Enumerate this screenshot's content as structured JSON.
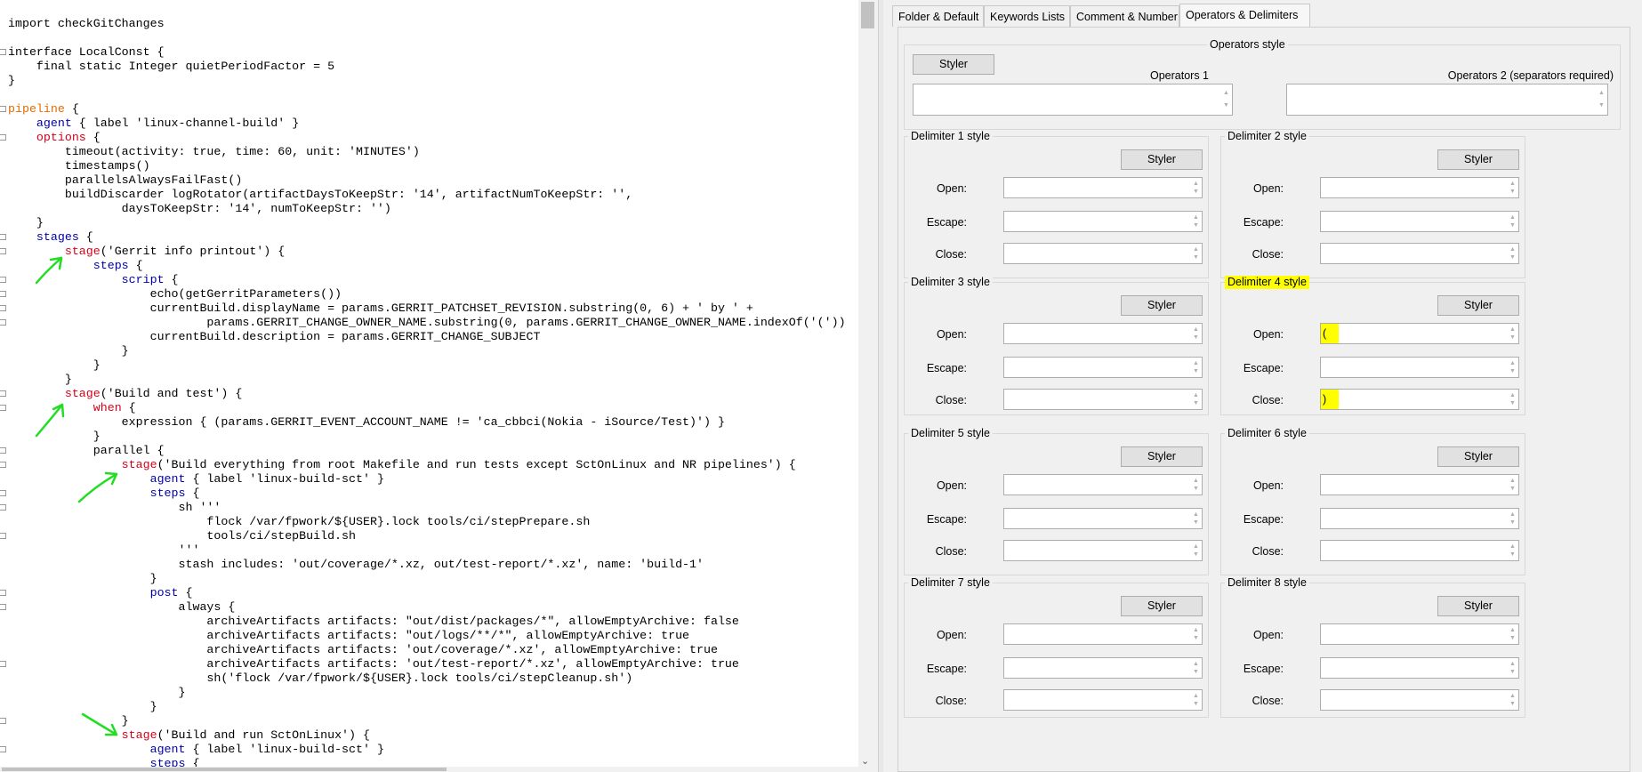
{
  "editor": {
    "lines": [
      [
        [
          "import checkGitChanges",
          ""
        ]
      ],
      [
        [
          "",
          ""
        ]
      ],
      [
        [
          "interface LocalConst {",
          ""
        ]
      ],
      [
        [
          "    final static Integer quietPeriodFactor = 5",
          ""
        ]
      ],
      [
        [
          "}",
          ""
        ]
      ],
      [
        [
          "",
          ""
        ]
      ],
      [
        [
          "pipeline",
          "o"
        ],
        [
          " {",
          ""
        ]
      ],
      [
        [
          "    ",
          ""
        ],
        [
          "agent",
          "k"
        ],
        [
          " { label 'linux-channel-build' }",
          ""
        ]
      ],
      [
        [
          "    ",
          ""
        ],
        [
          "options",
          "r"
        ],
        [
          " {",
          ""
        ]
      ],
      [
        [
          "        timeout(activity: true, time: 60, unit: 'MINUTES')",
          ""
        ]
      ],
      [
        [
          "        timestamps()",
          ""
        ]
      ],
      [
        [
          "        parallelsAlwaysFailFast()",
          ""
        ]
      ],
      [
        [
          "        buildDiscarder logRotator(artifactDaysToKeepStr: '14', artifactNumToKeepStr: '',",
          ""
        ]
      ],
      [
        [
          "                daysToKeepStr: '14', numToKeepStr: '')",
          ""
        ]
      ],
      [
        [
          "    }",
          ""
        ]
      ],
      [
        [
          "    ",
          ""
        ],
        [
          "stages",
          "k"
        ],
        [
          " {",
          ""
        ]
      ],
      [
        [
          "        ",
          ""
        ],
        [
          "stage",
          "r"
        ],
        [
          "('Gerrit info printout') {",
          ""
        ]
      ],
      [
        [
          "            ",
          ""
        ],
        [
          "steps",
          "k"
        ],
        [
          " {",
          ""
        ]
      ],
      [
        [
          "                ",
          ""
        ],
        [
          "script",
          "k"
        ],
        [
          " {",
          ""
        ]
      ],
      [
        [
          "                    echo(getGerritParameters())",
          ""
        ]
      ],
      [
        [
          "                    currentBuild.displayName = params.GERRIT_PATCHSET_REVISION.substring(0, 6) + ' by ' +",
          ""
        ]
      ],
      [
        [
          "                            params.GERRIT_CHANGE_OWNER_NAME.substring(0, params.GERRIT_CHANGE_OWNER_NAME.indexOf('('))",
          ""
        ]
      ],
      [
        [
          "                    currentBuild.description = params.GERRIT_CHANGE_SUBJECT",
          ""
        ]
      ],
      [
        [
          "                }",
          ""
        ]
      ],
      [
        [
          "            }",
          ""
        ]
      ],
      [
        [
          "        }",
          ""
        ]
      ],
      [
        [
          "        ",
          ""
        ],
        [
          "stage",
          "r"
        ],
        [
          "('Build and test') {",
          ""
        ]
      ],
      [
        [
          "            ",
          ""
        ],
        [
          "when",
          "r"
        ],
        [
          " {",
          ""
        ]
      ],
      [
        [
          "                expression { (params.GERRIT_EVENT_ACCOUNT_NAME != 'ca_cbbci(Nokia - iSource/Test)') }",
          ""
        ]
      ],
      [
        [
          "            }",
          ""
        ]
      ],
      [
        [
          "            parallel {",
          ""
        ]
      ],
      [
        [
          "                ",
          ""
        ],
        [
          "stage",
          "r"
        ],
        [
          "('Build everything from root Makefile and run tests except SctOnLinux and NR pipelines') {",
          ""
        ]
      ],
      [
        [
          "                    ",
          ""
        ],
        [
          "agent",
          "k"
        ],
        [
          " { label 'linux-build-sct' }",
          ""
        ]
      ],
      [
        [
          "                    ",
          ""
        ],
        [
          "steps",
          "k"
        ],
        [
          " {",
          ""
        ]
      ],
      [
        [
          "                        sh '''",
          ""
        ]
      ],
      [
        [
          "                            flock /var/fpwork/${USER}.lock tools/ci/stepPrepare.sh",
          ""
        ]
      ],
      [
        [
          "                            tools/ci/stepBuild.sh",
          ""
        ]
      ],
      [
        [
          "                        '''",
          ""
        ]
      ],
      [
        [
          "                        stash includes: 'out/coverage/*.xz, out/test-report/*.xz', name: 'build-1'",
          ""
        ]
      ],
      [
        [
          "                    }",
          ""
        ]
      ],
      [
        [
          "                    ",
          ""
        ],
        [
          "post",
          "k"
        ],
        [
          " {",
          ""
        ]
      ],
      [
        [
          "                        always {",
          ""
        ]
      ],
      [
        [
          "                            archiveArtifacts artifacts: \"out/dist/packages/*\", allowEmptyArchive: false",
          ""
        ]
      ],
      [
        [
          "                            archiveArtifacts artifacts: \"out/logs/**/*\", allowEmptyArchive: true",
          ""
        ]
      ],
      [
        [
          "                            archiveArtifacts artifacts: 'out/coverage/*.xz', allowEmptyArchive: true",
          ""
        ]
      ],
      [
        [
          "                            archiveArtifacts artifacts: 'out/test-report/*.xz', allowEmptyArchive: true",
          ""
        ]
      ],
      [
        [
          "                            sh('flock /var/fpwork/${USER}.lock tools/ci/stepCleanup.sh')",
          ""
        ]
      ],
      [
        [
          "                        }",
          ""
        ]
      ],
      [
        [
          "                    }",
          ""
        ]
      ],
      [
        [
          "                }",
          ""
        ]
      ],
      [
        [
          "                ",
          ""
        ],
        [
          "stage",
          "r"
        ],
        [
          "('Build and run SctOnLinux') {",
          ""
        ]
      ],
      [
        [
          "                    ",
          ""
        ],
        [
          "agent",
          "k"
        ],
        [
          " { label 'linux-build-sct' }",
          ""
        ]
      ],
      [
        [
          "                    ",
          ""
        ],
        [
          "steps",
          "k"
        ],
        [
          " {",
          ""
        ]
      ]
    ]
  },
  "settings": {
    "tabs": [
      "Folder & Default",
      "Keywords Lists",
      "Comment & Number",
      "Operators & Delimiters"
    ],
    "active_tab": "Operators & Delimiters",
    "operators": {
      "title": "Operators style",
      "styler": "Styler",
      "op1_label": "Operators 1",
      "op2_label": "Operators 2 (separators required)",
      "op1_value": "",
      "op2_value": ""
    },
    "labels": {
      "open": "Open:",
      "escape": "Escape:",
      "close": "Close:",
      "styler": "Styler"
    },
    "delimiters": [
      {
        "title": "Delimiter 1 style",
        "open": "",
        "escape": "",
        "close": ""
      },
      {
        "title": "Delimiter 2 style",
        "open": "",
        "escape": "",
        "close": ""
      },
      {
        "title": "Delimiter 3 style",
        "open": "",
        "escape": "",
        "close": ""
      },
      {
        "title": "Delimiter 4 style",
        "open": "(",
        "escape": "",
        "close": ")"
      },
      {
        "title": "Delimiter 5 style",
        "open": "",
        "escape": "",
        "close": ""
      },
      {
        "title": "Delimiter 6 style",
        "open": "",
        "escape": "",
        "close": ""
      },
      {
        "title": "Delimiter 7 style",
        "open": "",
        "escape": "",
        "close": ""
      },
      {
        "title": "Delimiter 8 style",
        "open": "",
        "escape": "",
        "close": ""
      }
    ]
  },
  "colors": {
    "keyword": "#0000a8",
    "stage_keyword": "#d4001a",
    "pipeline_keyword": "#e06c00",
    "highlight": "#ffff00",
    "annotation": "#22dd22"
  }
}
